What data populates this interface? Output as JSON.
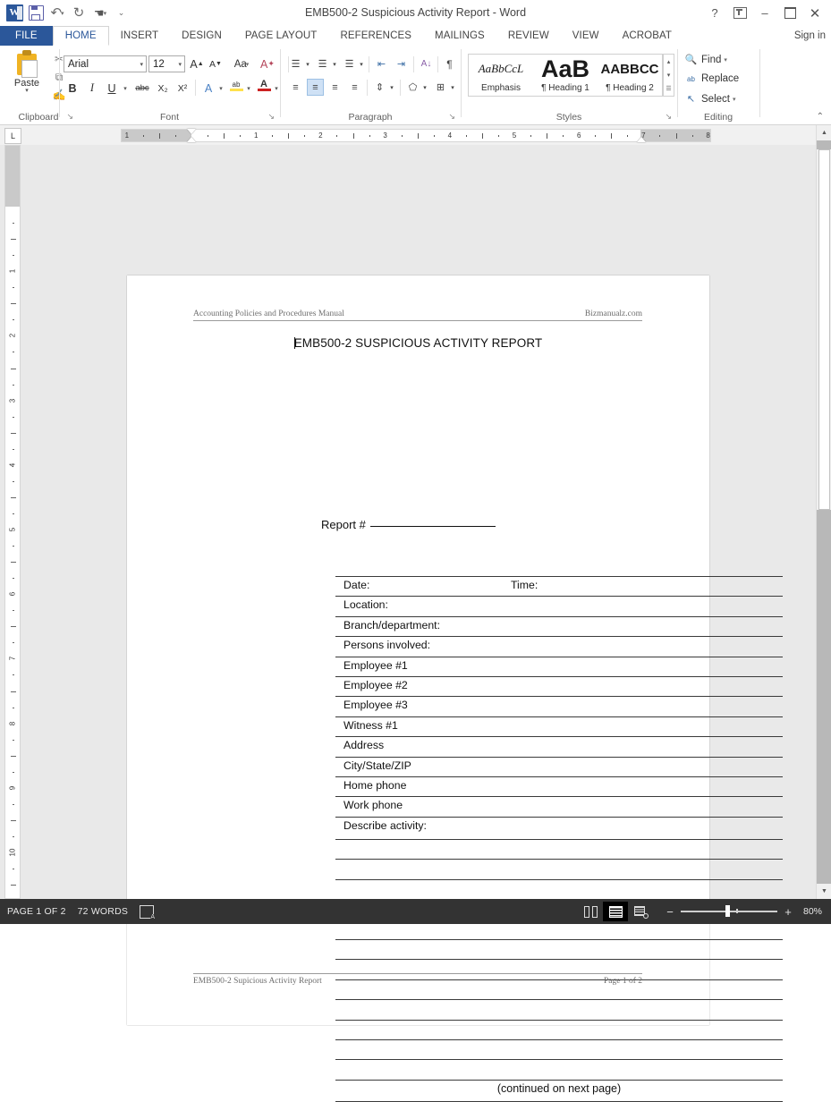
{
  "window": {
    "title": "EMB500-2 Suspicious Activity Report - Word",
    "sign_in": "Sign in",
    "help_icon": "?",
    "minimize_icon": "–",
    "close_icon": "✕"
  },
  "quick_access": {
    "logo_letter": "W",
    "save_icon": "save-icon",
    "undo_icon": "↶",
    "redo_icon": "↻",
    "touch_icon": "☚",
    "customize_icon": "☰"
  },
  "tabs": [
    {
      "label": "FILE",
      "state": "file"
    },
    {
      "label": "HOME",
      "state": "active"
    },
    {
      "label": "INSERT",
      "state": "normal"
    },
    {
      "label": "DESIGN",
      "state": "normal"
    },
    {
      "label": "PAGE LAYOUT",
      "state": "normal"
    },
    {
      "label": "REFERENCES",
      "state": "normal"
    },
    {
      "label": "MAILINGS",
      "state": "normal"
    },
    {
      "label": "REVIEW",
      "state": "normal"
    },
    {
      "label": "VIEW",
      "state": "normal"
    },
    {
      "label": "ACROBAT",
      "state": "normal"
    }
  ],
  "ribbon": {
    "clipboard": {
      "group_label": "Clipboard",
      "paste_label": "Paste",
      "paste_caret": "▾",
      "cut_icon": "✂",
      "copy_icon": "⧉",
      "format_painter_icon": "὘",
      "dialog_launcher": "↘"
    },
    "font": {
      "group_label": "Font",
      "font_name": "Arial",
      "font_size": "12",
      "grow_font": "A",
      "shrink_font": "A",
      "change_case": "Aa",
      "clear_formatting": "A",
      "bold": "B",
      "italic": "I",
      "underline": "U",
      "strikethrough": "abc",
      "subscript": "X₂",
      "superscript": "X²",
      "text_effects": "A",
      "highlight": "ab",
      "font_color": "A",
      "dialog_launcher": "↘"
    },
    "paragraph": {
      "group_label": "Paragraph",
      "bullets": "☰",
      "numbering": "☰",
      "multilevel": "☰",
      "decrease_indent": "⇤",
      "increase_indent": "⇥",
      "sort": "A↓",
      "show_marks": "¶",
      "align_left": "≡",
      "align_center": "≡",
      "align_right": "≡",
      "justify": "≡",
      "line_spacing": "↕",
      "shading": "△",
      "borders": "⊞",
      "dialog_launcher": "↘"
    },
    "styles": {
      "group_label": "Styles",
      "items": [
        {
          "preview": "AaBbCcL",
          "name": "Emphasis"
        },
        {
          "preview": "AaB",
          "name": "¶ Heading 1"
        },
        {
          "preview": "AABBCC",
          "name": "¶ Heading 2"
        }
      ],
      "scroll_up": "▴",
      "scroll_down": "▾",
      "more": "☰",
      "dialog_launcher": "↘"
    },
    "editing": {
      "group_label": "Editing",
      "find_label": "Find",
      "find_caret": "▾",
      "find_icon": "🔍",
      "replace_label": "Replace",
      "replace_icon": "ab",
      "select_label": "Select",
      "select_caret": "▾",
      "select_icon": "↖"
    },
    "collapse_icon": "⌃"
  },
  "ruler": {
    "tab_selector": "L",
    "h_numbers": [
      "1",
      "1",
      "2",
      "3",
      "4",
      "5",
      "6",
      "7"
    ],
    "v_numbers": [
      "1",
      "2",
      "3",
      "4",
      "5"
    ]
  },
  "document": {
    "header_left": "Accounting Policies and Procedures Manual",
    "header_right": "Bizmanualz.com",
    "title": "EMB500-2 SUSPICIOUS ACTIVITY REPORT",
    "report_label": "Report #",
    "form_rows": [
      {
        "label": "Date:",
        "label2": "Time:"
      },
      {
        "label": "Location:",
        "label2": ""
      },
      {
        "label": "Branch/department:",
        "label2": ""
      },
      {
        "label": "Persons involved:",
        "label2": ""
      },
      {
        "label": "Employee #1",
        "label2": ""
      },
      {
        "label": "Employee #2",
        "label2": ""
      },
      {
        "label": "Employee #3",
        "label2": ""
      },
      {
        "label": "Witness #1",
        "label2": ""
      },
      {
        "label": "Address",
        "label2": ""
      },
      {
        "label": "City/State/ZIP",
        "label2": ""
      },
      {
        "label": "Home phone",
        "label2": ""
      },
      {
        "label": "Work phone",
        "label2": ""
      },
      {
        "label": "Describe activity:",
        "label2": ""
      }
    ],
    "blank_line_count": 12,
    "continued_text": "(continued on next page)",
    "footer_left": "EMB500-2 Supicious Activity Report",
    "footer_right": "Page 1 of 2"
  },
  "status_bar": {
    "page_indicator": "PAGE 1 OF 2",
    "word_count": "72 WORDS",
    "proofing_icon": "proofing-errors-icon",
    "read_mode": "read-mode-icon",
    "print_layout": "print-layout-icon",
    "web_layout": "web-layout-icon",
    "zoom_out": "−",
    "zoom_in": "+",
    "zoom_value": "80%"
  }
}
